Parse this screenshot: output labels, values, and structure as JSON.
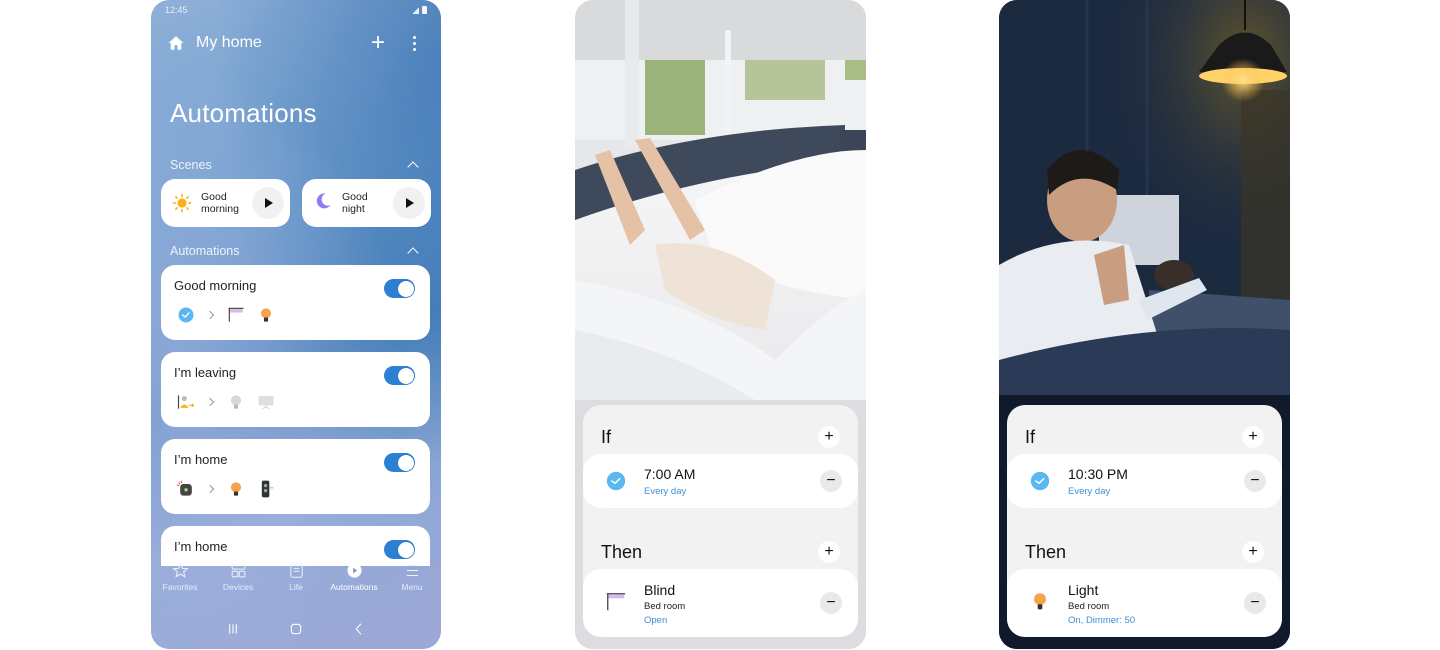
{
  "phone1": {
    "status_time": "12:45",
    "header_title": "My home",
    "page_title": "Automations",
    "scenes_label": "Scenes",
    "scenes": [
      {
        "label_line1": "Good",
        "label_line2": "morning",
        "icon": "sun-icon"
      },
      {
        "label_line1": "Good",
        "label_line2": "night",
        "icon": "moon-icon"
      }
    ],
    "automations_label": "Automations",
    "automations": [
      {
        "name": "Good morning",
        "enabled": true,
        "condition_icons": [
          "clock-icon"
        ],
        "action_icons": [
          "blind-icon",
          "bulb-icon"
        ]
      },
      {
        "name": "I’m leaving",
        "enabled": true,
        "condition_icons": [
          "person-leaving-icon"
        ],
        "action_icons": [
          "bulb-off-icon",
          "tv-icon"
        ]
      },
      {
        "name": "I’m home",
        "enabled": true,
        "condition_icons": [
          "sensor-icon"
        ],
        "action_icons": [
          "bulb-icon",
          "speaker-icon"
        ]
      },
      {
        "name": "I’m home",
        "enabled": true
      }
    ],
    "nav": [
      {
        "label": "Favorites",
        "icon": "star-icon",
        "active": false
      },
      {
        "label": "Devices",
        "icon": "devices-icon",
        "active": false
      },
      {
        "label": "Life",
        "icon": "life-icon",
        "active": false
      },
      {
        "label": "Automations",
        "icon": "play-circle-icon",
        "active": true
      },
      {
        "label": "Menu",
        "icon": "menu-icon",
        "active": false
      }
    ]
  },
  "phone2": {
    "if_label": "If",
    "then_label": "Then",
    "condition": {
      "title": "7:00 AM",
      "detail": "Every day"
    },
    "action": {
      "title": "Blind",
      "room": "Bed room",
      "state": "Open"
    }
  },
  "phone3": {
    "if_label": "If",
    "then_label": "Then",
    "condition": {
      "title": "10:30 PM",
      "detail": "Every day"
    },
    "action": {
      "title": "Light",
      "room": "Bed room",
      "state": "On, Dimmer: 50"
    }
  },
  "colors": {
    "toggle_on": "#2d7fd3",
    "link_blue": "#3b8fd6",
    "clock_blue": "#5bb7f0",
    "bulb_orange": "#f5a34a"
  }
}
